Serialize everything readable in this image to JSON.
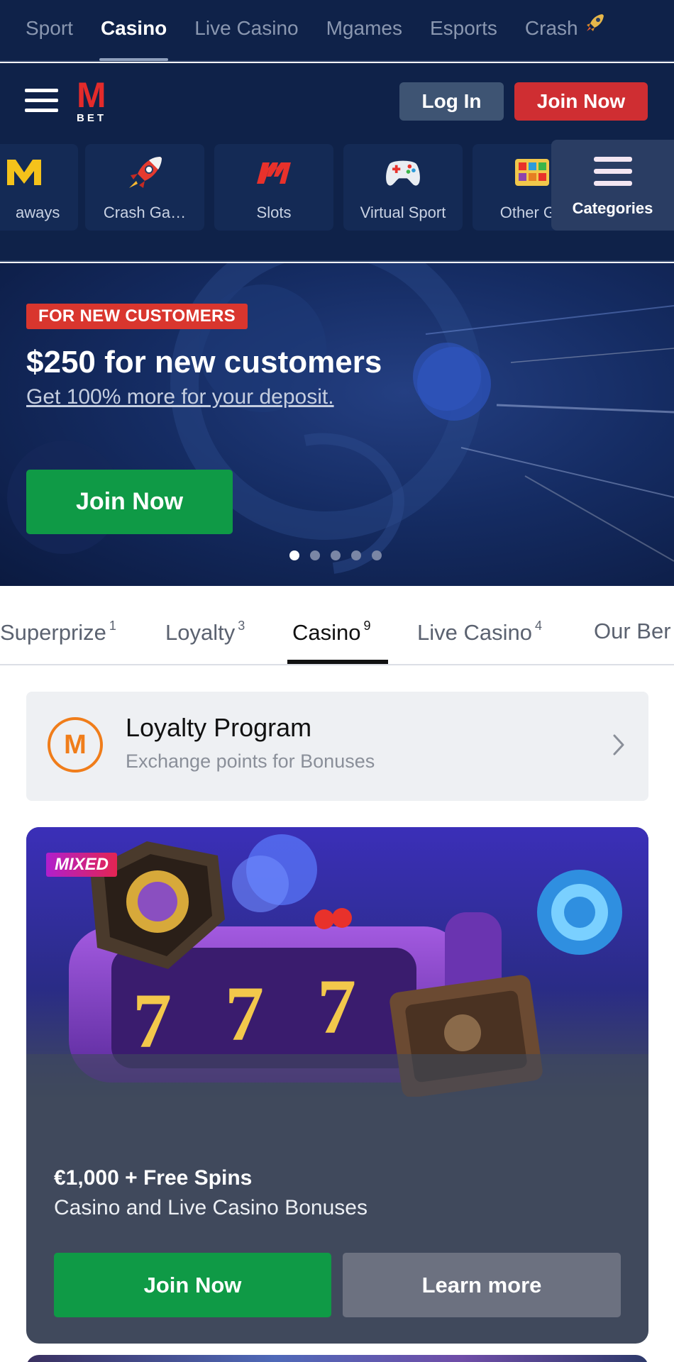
{
  "top_nav": {
    "tabs": [
      {
        "label": "Sport",
        "active": false
      },
      {
        "label": "Casino",
        "active": true
      },
      {
        "label": "Live Casino",
        "active": false
      },
      {
        "label": "Mgames",
        "active": false
      },
      {
        "label": "Esports",
        "active": false
      },
      {
        "label": "Crash",
        "active": false,
        "icon": "rocket-icon"
      }
    ]
  },
  "header": {
    "logo_letter": "M",
    "logo_sub": "BET",
    "login_label": "Log In",
    "join_label": "Join Now"
  },
  "categories": {
    "items": [
      {
        "label": "aways",
        "icon": "m-logo-icon"
      },
      {
        "label": "Crash Ga…",
        "icon": "rocket-icon"
      },
      {
        "label": "Slots",
        "icon": "slots-m-icon"
      },
      {
        "label": "Virtual Sport",
        "icon": "gamepad-icon"
      },
      {
        "label": "Other Ga",
        "icon": "other-games-icon"
      }
    ],
    "more_label": "Categories"
  },
  "banner": {
    "badge": "FOR NEW CUSTOMERS",
    "title": "$250 for new customers",
    "subtitle": "Get 100% more for your deposit.",
    "cta": "Join Now",
    "slides_total": 5,
    "slide_active": 1
  },
  "bonus_tabs": {
    "items": [
      {
        "label": "Superprize",
        "count": "1",
        "active": false
      },
      {
        "label": "Loyalty",
        "count": "3",
        "active": false
      },
      {
        "label": "Casino",
        "count": "9",
        "active": true
      },
      {
        "label": "Live Casino",
        "count": "4",
        "active": false
      },
      {
        "label": "Our Ber",
        "count": "",
        "active": false
      }
    ]
  },
  "loyalty": {
    "logo_letter": "M",
    "title": "Loyalty Program",
    "subtitle": "Exchange points for Bonuses"
  },
  "casino_card": {
    "badge": "MIXED",
    "title": "€1,000 + Free Spins",
    "subtitle": "Casino and Live Casino Bonuses",
    "join_label": "Join Now",
    "learn_label": "Learn more"
  },
  "colors": {
    "navy": "#0f2249",
    "red": "#cf2e32",
    "green": "#0f9a46",
    "orange": "#f07d1a",
    "card_bg": "#40495c"
  }
}
